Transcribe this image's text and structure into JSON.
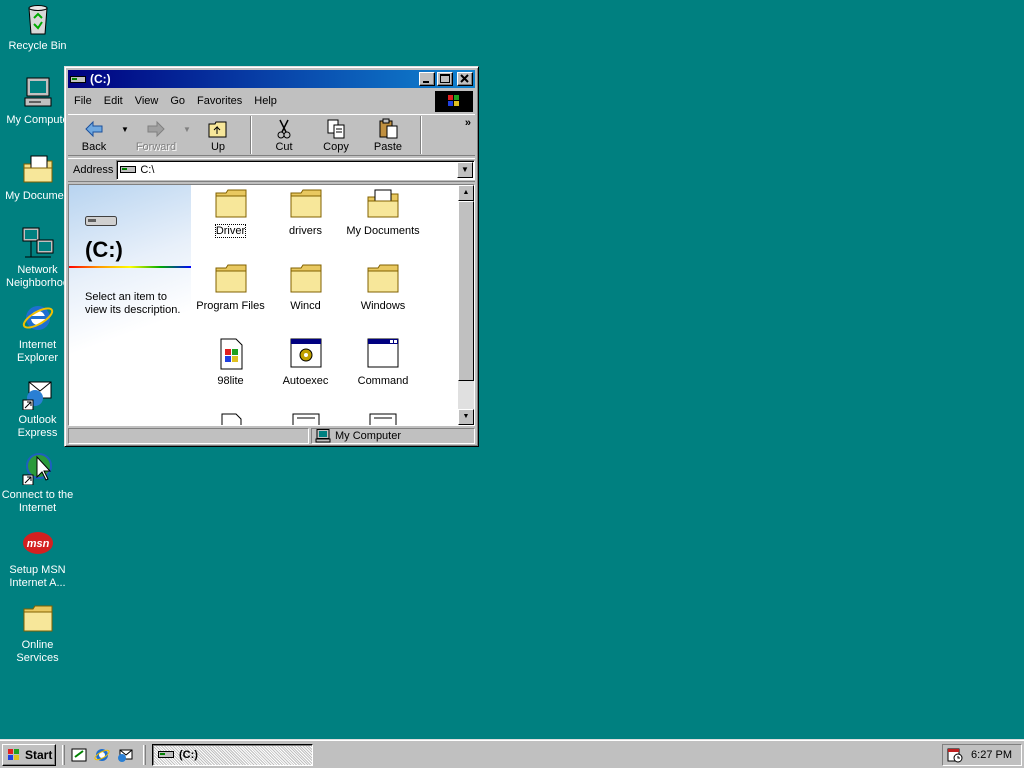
{
  "desktop": {
    "icons": [
      {
        "label_line1": "Recycle Bin",
        "label_line2": "",
        "icon": "recycle-bin-icon"
      },
      {
        "label_line1": "My Compute",
        "label_line2": "",
        "icon": "my-computer-icon"
      },
      {
        "label_line1": "My Documen",
        "label_line2": "",
        "icon": "my-documents-icon"
      },
      {
        "label_line1": "Network",
        "label_line2": "Neighborhoo",
        "icon": "network-neighborhood-icon"
      },
      {
        "label_line1": "Internet",
        "label_line2": "Explorer",
        "icon": "internet-explorer-icon"
      },
      {
        "label_line1": "Outlook",
        "label_line2": "Express",
        "icon": "outlook-express-icon"
      },
      {
        "label_line1": "Connect to the",
        "label_line2": "Internet",
        "icon": "connect-internet-icon"
      },
      {
        "label_line1": "Setup MSN",
        "label_line2": "Internet A...",
        "icon": "msn-icon"
      },
      {
        "label_line1": "Online",
        "label_line2": "Services",
        "icon": "folder-icon"
      }
    ]
  },
  "window": {
    "title": "(C:)",
    "menu": [
      "File",
      "Edit",
      "View",
      "Go",
      "Favorites",
      "Help"
    ],
    "toolbar": {
      "back": "Back",
      "forward": "Forward",
      "up": "Up",
      "cut": "Cut",
      "copy": "Copy",
      "paste": "Paste",
      "more": "»"
    },
    "address": {
      "label": "Address",
      "value": "C:\\"
    },
    "webview": {
      "title": "(C:)",
      "description": "Select an item to view its description."
    },
    "files": [
      {
        "name": "Driver",
        "type": "folder",
        "selected": true
      },
      {
        "name": "drivers",
        "type": "folder"
      },
      {
        "name": "My Documents",
        "type": "docs-folder"
      },
      {
        "name": "Program Files",
        "type": "folder"
      },
      {
        "name": "Wincd",
        "type": "folder"
      },
      {
        "name": "Windows",
        "type": "folder"
      },
      {
        "name": "98lite",
        "type": "exe"
      },
      {
        "name": "Autoexec",
        "type": "bat"
      },
      {
        "name": "Command",
        "type": "com"
      }
    ],
    "status": {
      "location": "My Computer"
    }
  },
  "taskbar": {
    "start_label": "Start",
    "task_title": "(C:)",
    "clock": "6:27 PM"
  },
  "colors": {
    "desktop": "#008080",
    "title_active": "#000080",
    "folder_yellow": "#f5e08a"
  }
}
